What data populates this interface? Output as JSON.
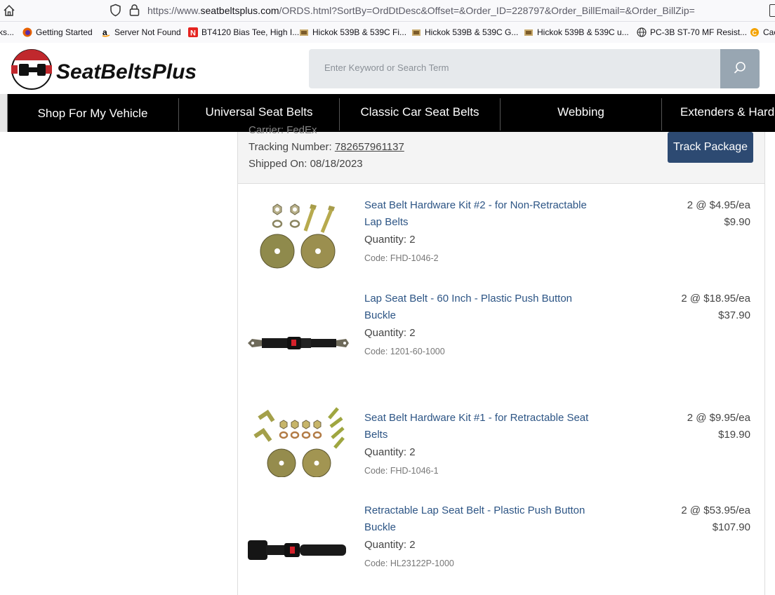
{
  "browser": {
    "url_prefix": "https://www.",
    "url_domain": "seatbeltsplus.com",
    "url_path": "/ORDS.html?SortBy=OrdDtDesc&Offset=&Order_ID=228797&Order_BillEmail=&Order_BillZip=",
    "bookmarks": [
      {
        "label": "ks...",
        "icon": "none"
      },
      {
        "label": "Getting Started",
        "icon": "firefox-icon"
      },
      {
        "label": "Server Not Found",
        "icon": "amazon-icon"
      },
      {
        "label": "BT4120 Bias Tee, High I...",
        "icon": "n-icon"
      },
      {
        "label": "Hickok 539B & 539C Fi...",
        "icon": "folder-image-icon"
      },
      {
        "label": "Hickok 539B & 539C G...",
        "icon": "folder-image-icon"
      },
      {
        "label": "Hickok 539B & 539C u...",
        "icon": "folder-image-icon"
      },
      {
        "label": "PC-3B ST-70 MF Resist...",
        "icon": "globe-icon"
      },
      {
        "label": "Cac",
        "icon": "c-icon"
      }
    ]
  },
  "site": {
    "logo_text": "SeatBeltsPlus",
    "search_placeholder": "Enter Keyword or Search Term",
    "nav": [
      "Shop For My Vehicle",
      "Universal Seat Belts",
      "Classic Car Seat Belts",
      "Webbing",
      "Extenders & Hard"
    ]
  },
  "shipment": {
    "carrier_line": "Carrier: FedEx",
    "tracking_label": "Tracking Number:",
    "tracking_number": "782657961137",
    "shipped_label": "Shipped On:",
    "shipped_date": "08/18/2023",
    "track_button": "Track Package"
  },
  "items": [
    {
      "title": "Seat Belt Hardware Kit #2 - for Non-Retractable Lap Belts",
      "quantity": "Quantity: 2",
      "code": "Code: FHD-1046-2",
      "unit": "2 @ $4.95/ea",
      "total": "$9.90",
      "icon": "hardware-kit-2-image"
    },
    {
      "title": "Lap Seat Belt - 60 Inch - Plastic Push Button Buckle",
      "quantity": "Quantity: 2",
      "code": "Code: 1201-60-1000",
      "unit": "2 @ $18.95/ea",
      "total": "$37.90",
      "icon": "lap-belt-image"
    },
    {
      "title": "Seat Belt Hardware Kit #1 - for Retractable Seat Belts",
      "quantity": "Quantity: 2",
      "code": "Code: FHD-1046-1",
      "unit": "2 @ $9.95/ea",
      "total": "$19.90",
      "icon": "hardware-kit-1-image"
    },
    {
      "title": "Retractable Lap Seat Belt - Plastic Push Button Buckle",
      "quantity": "Quantity: 2",
      "code": "Code: HL23122P-1000",
      "unit": "2 @ $53.95/ea",
      "total": "$107.90",
      "icon": "retractable-belt-image"
    }
  ],
  "colors": {
    "nav_bg": "#000000",
    "link": "#2d5585",
    "button": "#2d4a72",
    "search_btn": "#98a6b2"
  }
}
